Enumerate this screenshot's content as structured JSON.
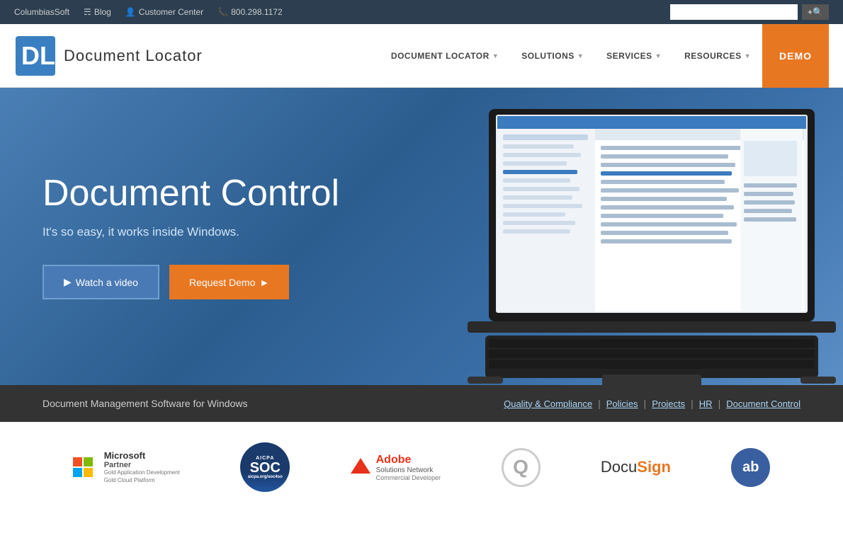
{
  "topbar": {
    "columbiasoft": "ColumbiasSoft",
    "blog": "Blog",
    "customer_center": "Customer Center",
    "phone": "800.298.1172",
    "search_placeholder": "",
    "search_button": "+🔍"
  },
  "navbar": {
    "logo_text": "Document Locator",
    "links": [
      {
        "label": "DOCUMENT LOCATOR",
        "has_arrow": true
      },
      {
        "label": "SOLUTIONS",
        "has_arrow": true
      },
      {
        "label": "SERVICES",
        "has_arrow": true
      },
      {
        "label": "RESOURCES",
        "has_arrow": true
      }
    ],
    "demo_label": "DEMO"
  },
  "hero": {
    "title": "Document Control",
    "subtitle": "It's so easy, it works inside Windows.",
    "btn_video": "Watch a video",
    "btn_demo": "Request Demo"
  },
  "bottombar": {
    "tagline": "Document Management Software for Windows",
    "links": [
      {
        "label": "Quality & Compliance"
      },
      {
        "label": "Policies"
      },
      {
        "label": "Projects"
      },
      {
        "label": "HR"
      },
      {
        "label": "Document Control"
      }
    ]
  },
  "partners": [
    {
      "name": "Microsoft Partner"
    },
    {
      "name": "AICPA SOC"
    },
    {
      "name": "Adobe Solutions Network"
    },
    {
      "name": "Q1 logo"
    },
    {
      "name": "DocuSign"
    },
    {
      "name": "ab circle"
    }
  ]
}
